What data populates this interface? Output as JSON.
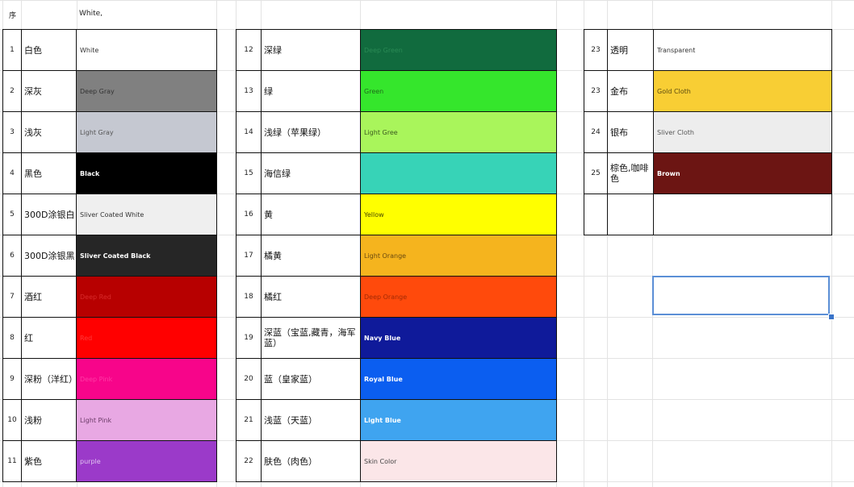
{
  "header": {
    "col_seq": "序",
    "white_label": "White,"
  },
  "colors": {
    "white": "#ffffff",
    "deep_gray": "#808080",
    "light_gray": "#c5c8d1",
    "black": "#000000",
    "silver_white": "#efefef",
    "silver_black": "#262626",
    "deep_red": "#b70000",
    "red": "#ff0000",
    "deep_pink": "#f7058a",
    "light_pink": "#e8a8e3",
    "purple": "#9b3ac9",
    "deep_green": "#116b3e",
    "green": "#35e62c",
    "light_green": "#a9f55b",
    "aqua": "#37d3b7",
    "yellow": "#ffff00",
    "light_orange": "#f5b41e",
    "deep_orange": "#ff4a0c",
    "navy": "#0f1a9a",
    "royal_blue": "#0b5ef0",
    "light_blue": "#3fa4f0",
    "skin": "#fbe6e8",
    "gold": "#f8ce34",
    "silver": "#ededed",
    "brown": "#6c1513"
  },
  "group1": [
    {
      "num": "1",
      "zh": "白色",
      "en": "White",
      "bg": "#ffffff",
      "fg": "#333333",
      "bold": false
    },
    {
      "num": "2",
      "zh": "深灰",
      "en": "Deep Gray",
      "bg": "#808080",
      "fg": "#333333",
      "bold": false
    },
    {
      "num": "3",
      "zh": "浅灰",
      "en": "Light Gray",
      "bg": "#c5c8d1",
      "fg": "#555555",
      "bold": false
    },
    {
      "num": "4",
      "zh": "黑色",
      "en": "Black",
      "bg": "#000000",
      "fg": "#ffffff",
      "bold": true
    },
    {
      "num": "5",
      "zh": "300D涂银白",
      "en": "Sliver Coated White",
      "bg": "#efefef",
      "fg": "#333333",
      "bold": false
    },
    {
      "num": "6",
      "zh": "300D涂银黑",
      "en": "Sliver Coated Black",
      "bg": "#262626",
      "fg": "#ffffff",
      "bold": true
    },
    {
      "num": "7",
      "zh": "酒红",
      "en": "Deep Red",
      "bg": "#b70000",
      "fg": "#d92a2a",
      "bold": false
    },
    {
      "num": "8",
      "zh": "红",
      "en": "Red",
      "bg": "#ff0000",
      "fg": "#ff3a3a",
      "bold": false
    },
    {
      "num": "9",
      "zh": "深粉（洋红）",
      "en": "Deep Pink",
      "bg": "#f7058a",
      "fg": "#ff3aa5",
      "bold": false
    },
    {
      "num": "10",
      "zh": "浅粉",
      "en": "Light Pink",
      "bg": "#e8a8e3",
      "fg": "#6a3a66",
      "bold": false
    },
    {
      "num": "11",
      "zh": "紫色",
      "en": "purple",
      "bg": "#9b3ac9",
      "fg": "#e0c5f0",
      "bold": false
    }
  ],
  "group2": [
    {
      "num": "12",
      "zh": "深绿",
      "en": "Deep Green",
      "bg": "#116b3e",
      "fg": "#2a8a55",
      "bold": false
    },
    {
      "num": "13",
      "zh": "绿",
      "en": "Green",
      "bg": "#35e62c",
      "fg": "#1f6a1a",
      "bold": false
    },
    {
      "num": "14",
      "zh": "浅绿（苹果绿）",
      "en": "Light Gree",
      "bg": "#a9f55b",
      "fg": "#3c5a1f",
      "bold": false
    },
    {
      "num": "15",
      "zh": "海信绿",
      "en": "",
      "bg": "#37d3b7",
      "fg": "#333333",
      "bold": false
    },
    {
      "num": "16",
      "zh": "黄",
      "en": "Yellow",
      "bg": "#ffff00",
      "fg": "#4a4a00",
      "bold": false
    },
    {
      "num": "17",
      "zh": "橘黄",
      "en": "Light Orange",
      "bg": "#f5b41e",
      "fg": "#6a4a10",
      "bold": false
    },
    {
      "num": "18",
      "zh": "橘红",
      "en": "Deep Orange",
      "bg": "#ff4a0c",
      "fg": "#a32a05",
      "bold": false
    },
    {
      "num": "19",
      "zh": "深蓝（宝蓝,藏青，海军蓝）",
      "en": "Navy Blue",
      "bg": "#0f1a9a",
      "fg": "#ffffff",
      "bold": true
    },
    {
      "num": "20",
      "zh": "蓝（皇家蓝）",
      "en": "Royal Blue",
      "bg": "#0b5ef0",
      "fg": "#ffffff",
      "bold": true
    },
    {
      "num": "21",
      "zh": "浅蓝（天蓝）",
      "en": "Light Blue",
      "bg": "#3fa4f0",
      "fg": "#ffffff",
      "bold": true
    },
    {
      "num": "22",
      "zh": "肤色（肉色）",
      "en": "Skin Color",
      "bg": "#fbe6e8",
      "fg": "#444444",
      "bold": false
    }
  ],
  "group3": [
    {
      "num": "23",
      "zh": "透明",
      "en": "Transparent",
      "bg": "#ffffff",
      "fg": "#333333",
      "bold": false
    },
    {
      "num": "23",
      "zh": "金布",
      "en": "Gold Cloth",
      "bg": "#f8ce34",
      "fg": "#5a4a10",
      "bold": false
    },
    {
      "num": "24",
      "zh": "银布",
      "en": "Sliver Cloth",
      "bg": "#ededed",
      "fg": "#555555",
      "bold": false
    },
    {
      "num": "25",
      "zh": "棕色,咖啡色",
      "en": "Brown",
      "bg": "#6c1513",
      "fg": "#ffffff",
      "bold": true
    },
    {
      "num": "",
      "zh": "",
      "en": "",
      "bg": "#ffffff",
      "fg": "#333333",
      "bold": false
    }
  ]
}
